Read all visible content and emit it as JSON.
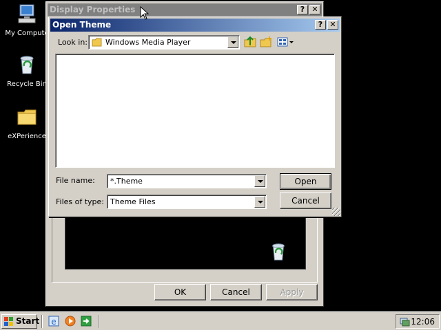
{
  "desktop": {
    "icons": [
      {
        "label": "My Compute",
        "icon": "my-computer-icon"
      },
      {
        "label": "Recycle Bin",
        "icon": "recycle-bin-icon"
      },
      {
        "label": "eXPerience",
        "icon": "folder-icon"
      }
    ]
  },
  "display_properties": {
    "title": "Display Properties",
    "help": "?",
    "close": "✕",
    "ok_label": "OK",
    "cancel_label": "Cancel",
    "apply_label": "Apply"
  },
  "open_theme": {
    "title": "Open Theme",
    "help": "?",
    "close": "✕",
    "look_in_label": "Look in:",
    "look_in_value": "Windows Media Player",
    "file_name_label": "File name:",
    "file_name_value": "*.Theme",
    "files_of_type_label": "Files of type:",
    "files_of_type_value": "Theme Files",
    "open_label": "Open",
    "cancel_label": "Cancel"
  },
  "taskbar": {
    "start_label": "Start",
    "clock": "12:06"
  },
  "colors": {
    "active_title_start": "#0a246a",
    "active_title_end": "#a6caf0",
    "inactive_title": "#808080",
    "face": "#d4d0c8"
  }
}
